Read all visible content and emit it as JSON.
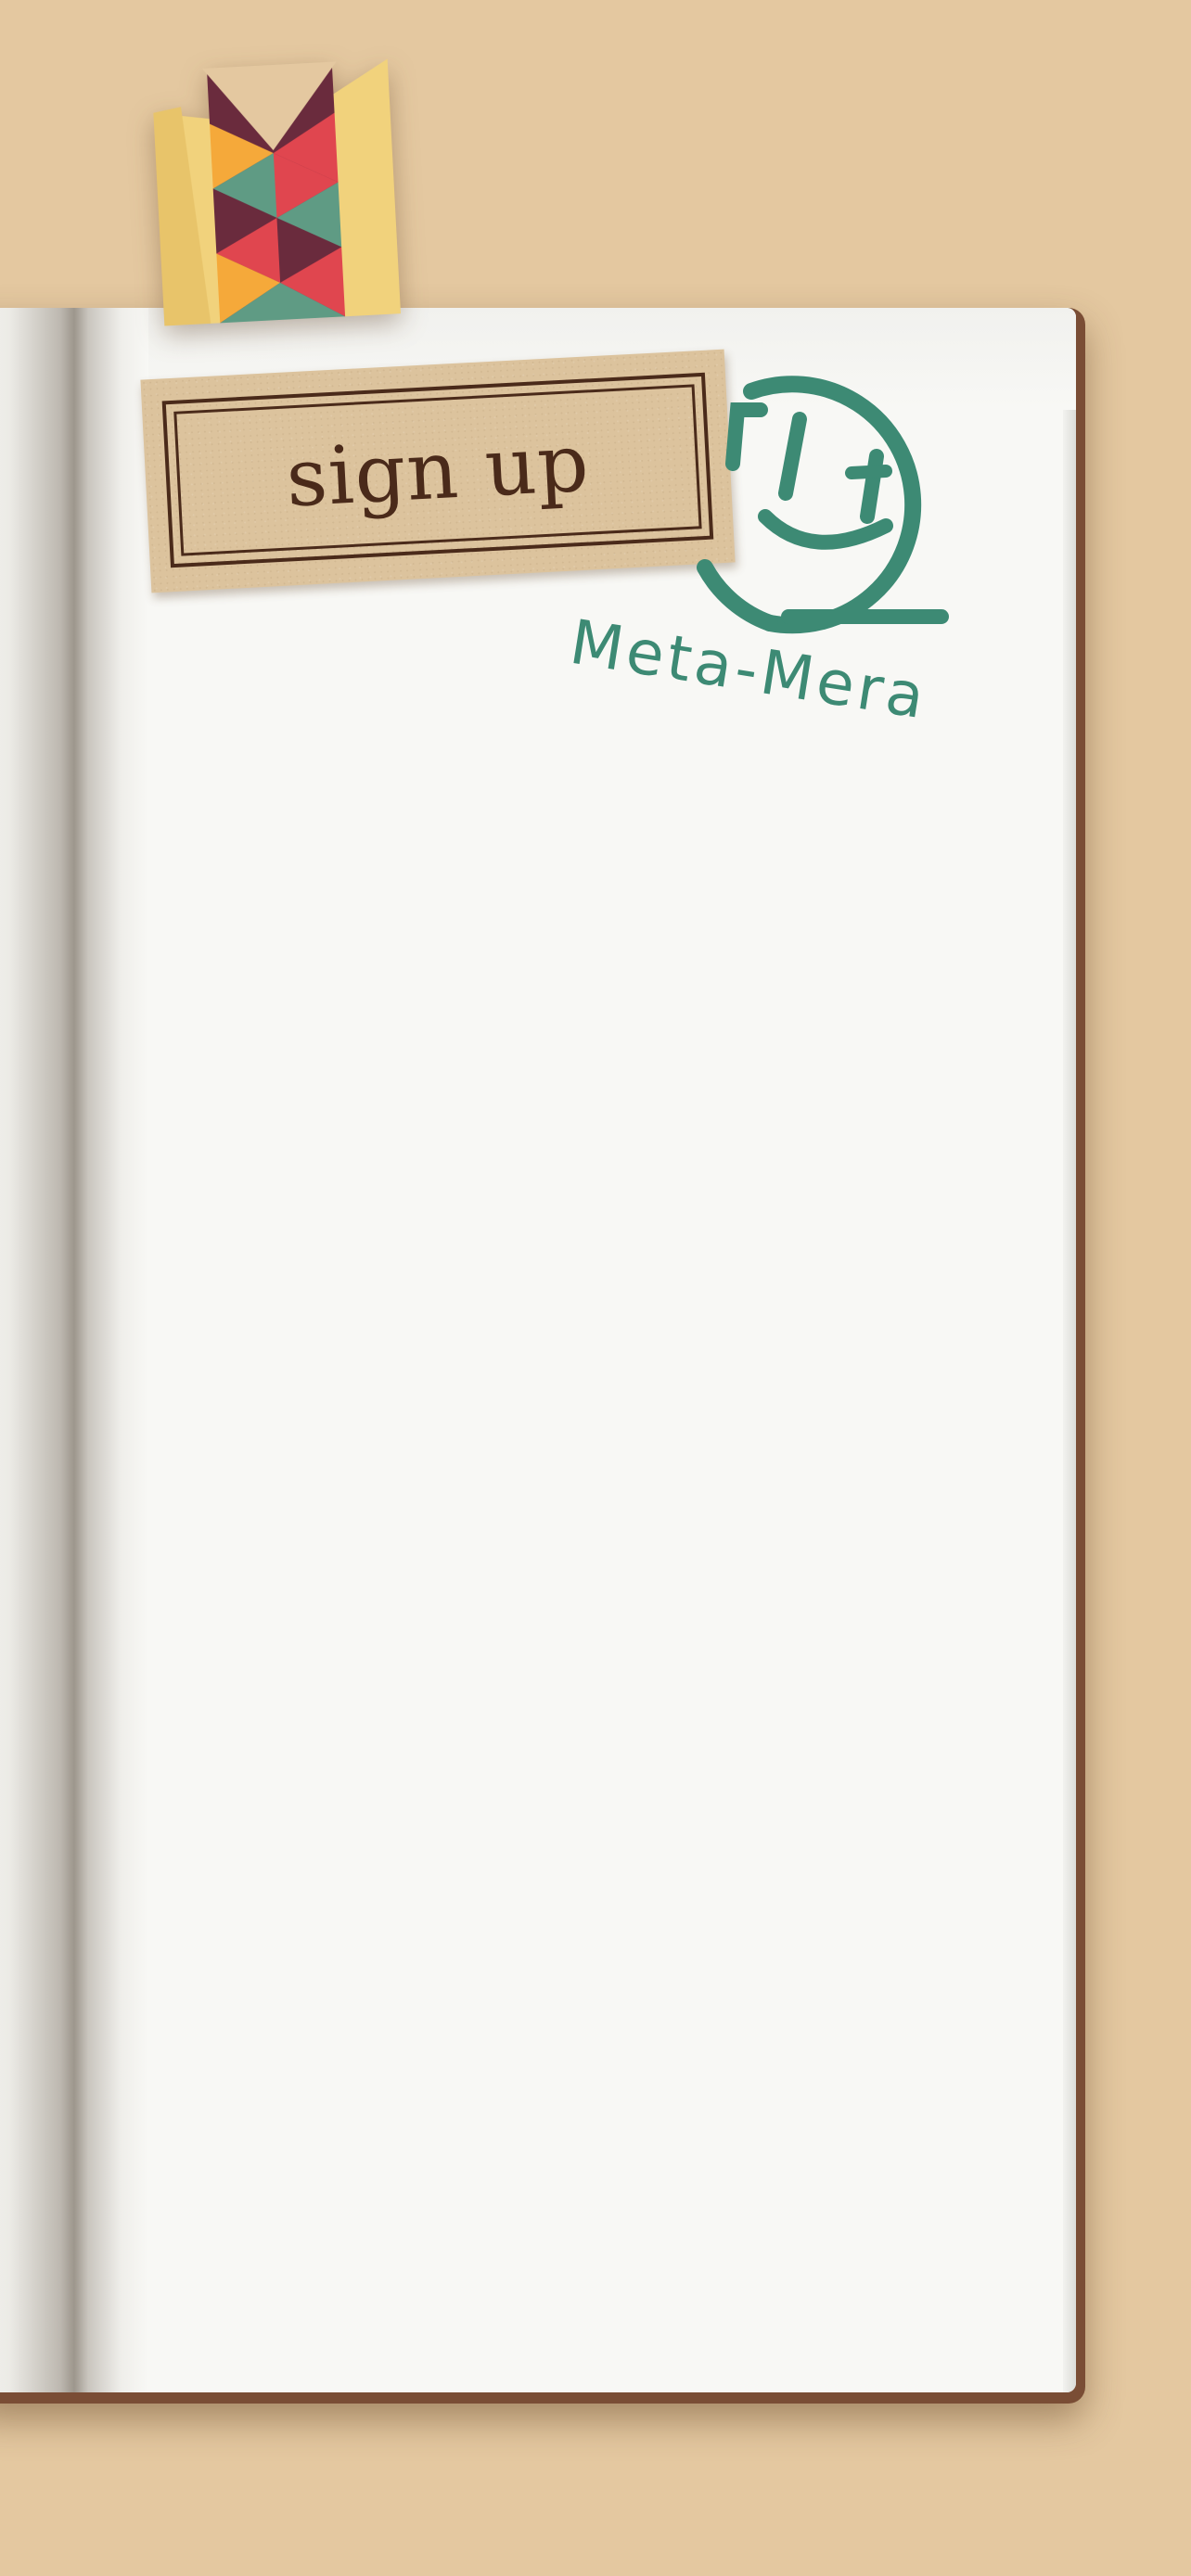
{
  "signup": {
    "label": "sign up"
  },
  "logo": {
    "text": "Meta-Mera",
    "icon": "smiley-face-icon",
    "color": "#3d8a74"
  },
  "bookmark": {
    "icon": "bookmark-ribbon-icon",
    "colors": [
      "#f1d27c",
      "#6a2b3d",
      "#e0464f",
      "#5f9b84",
      "#f5a93a"
    ]
  },
  "colors": {
    "background": "#e4c8a0",
    "page": "#f8f8f5",
    "label": "#dcc39d",
    "label_ink": "#4a2a1a"
  }
}
